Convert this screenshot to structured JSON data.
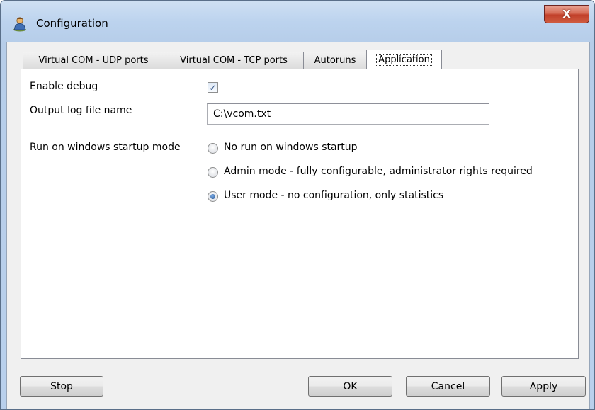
{
  "window": {
    "title": "Configuration",
    "icon": "network-user-icon",
    "close_label": "X"
  },
  "tabs": [
    {
      "label": "Virtual COM - UDP ports",
      "active": false
    },
    {
      "label": "Virtual COM - TCP ports",
      "active": false
    },
    {
      "label": "Autoruns",
      "active": false
    },
    {
      "label": "Application",
      "active": true
    }
  ],
  "form": {
    "debug_label": "Enable debug",
    "debug_checked": true,
    "log_label": "Output log file name",
    "log_value": "C:\\vcom.txt",
    "startup_label": "Run on windows startup mode",
    "startup_options": [
      {
        "label": "No run on windows startup",
        "checked": false
      },
      {
        "label": "Admin mode - fully configurable, administrator rights required",
        "checked": false
      },
      {
        "label": "User mode - no configuration, only statistics",
        "checked": true
      }
    ]
  },
  "buttons": {
    "stop": "Stop",
    "ok": "OK",
    "cancel": "Cancel",
    "apply": "Apply"
  }
}
